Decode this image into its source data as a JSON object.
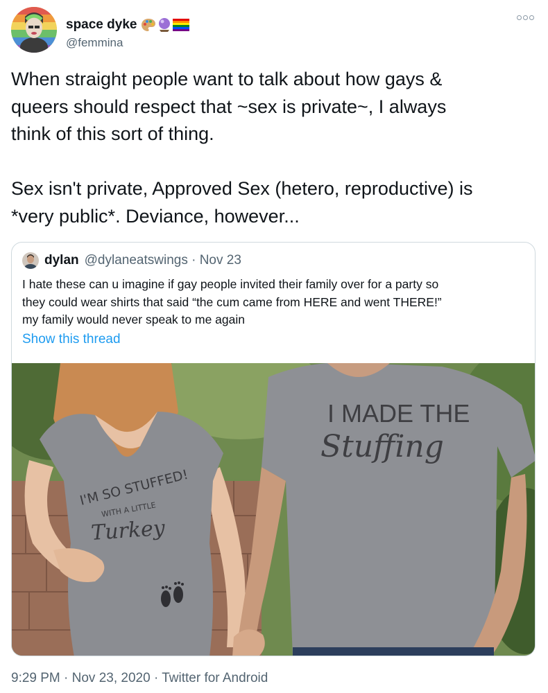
{
  "author": {
    "display_name": "space dyke",
    "handle": "@femmina",
    "emoji_icons": [
      "artist-palette-icon",
      "crystal-ball-icon",
      "rainbow-flag-icon"
    ]
  },
  "tweet": {
    "text": "When straight people want to talk about how gays &\nqueers should respect that ~sex is private~, I always\nthink of this sort of thing.\n\nSex isn't private, Approved Sex (hetero, reproductive) is\n*very public*. Deviance, however..."
  },
  "quoted_tweet": {
    "name": "dylan",
    "handle_date": "@dylaneatswings · Nov 23",
    "text": "I hate these can u imagine if gay people invited their family over for a party so\nthey could wear shirts that said “the cum came from HERE and went THERE!”\nmy family would never speak to me again",
    "show_thread": "Show this thread",
    "image": {
      "left_shirt_line1": "I'M SO STUFFED!",
      "left_shirt_line2": "WITH A LITTLE",
      "left_shirt_line3": "Turkey",
      "right_shirt_line1": "I MADE THE",
      "right_shirt_line2": "Stuffing"
    }
  },
  "footer": {
    "timestamp_source": "9:29 PM · Nov 23, 2020 · Twitter for Android"
  },
  "colors": {
    "link": "#1d9bf0",
    "secondary_text": "#536471",
    "border": "#cfd9de"
  }
}
